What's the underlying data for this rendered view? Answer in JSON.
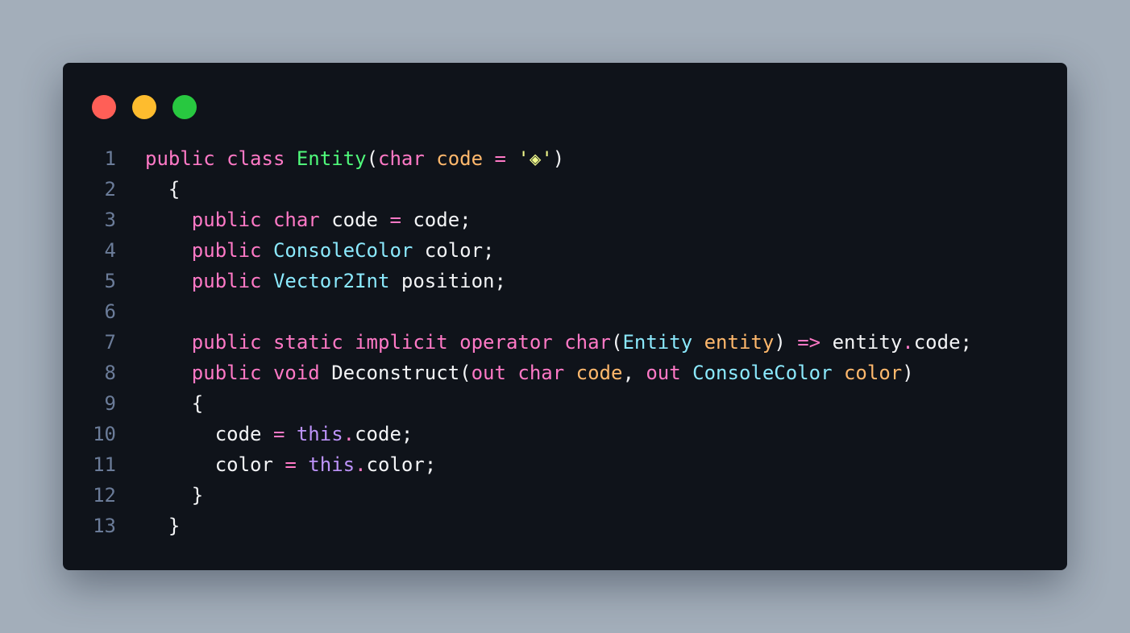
{
  "window": {
    "controls": {
      "close_color": "#ff5f57",
      "minimize_color": "#febc2e",
      "maximize_color": "#28c840"
    }
  },
  "code": {
    "lines": [
      {
        "number": "1",
        "tokens": [
          {
            "text": "public ",
            "kind": "kw"
          },
          {
            "text": "class ",
            "kind": "kw"
          },
          {
            "text": "Entity",
            "kind": "cls"
          },
          {
            "text": "(",
            "kind": "pl"
          },
          {
            "text": "char ",
            "kind": "kw"
          },
          {
            "text": "code ",
            "kind": "pr"
          },
          {
            "text": "= ",
            "kind": "op"
          },
          {
            "text": "'◈'",
            "kind": "st"
          },
          {
            "text": ")",
            "kind": "pl"
          }
        ]
      },
      {
        "number": "2",
        "tokens": [
          {
            "text": "  {",
            "kind": "pl"
          }
        ]
      },
      {
        "number": "3",
        "tokens": [
          {
            "text": "    public ",
            "kind": "kw"
          },
          {
            "text": "char ",
            "kind": "kw"
          },
          {
            "text": "code ",
            "kind": "pl"
          },
          {
            "text": "= ",
            "kind": "op"
          },
          {
            "text": "code;",
            "kind": "pl"
          }
        ]
      },
      {
        "number": "4",
        "tokens": [
          {
            "text": "    public ",
            "kind": "kw"
          },
          {
            "text": "ConsoleColor ",
            "kind": "ty"
          },
          {
            "text": "color;",
            "kind": "pl"
          }
        ]
      },
      {
        "number": "5",
        "tokens": [
          {
            "text": "    public ",
            "kind": "kw"
          },
          {
            "text": "Vector2Int ",
            "kind": "ty"
          },
          {
            "text": "position;",
            "kind": "pl"
          }
        ]
      },
      {
        "number": "6",
        "tokens": []
      },
      {
        "number": "7",
        "tokens": [
          {
            "text": "    public ",
            "kind": "kw"
          },
          {
            "text": "static ",
            "kind": "kw"
          },
          {
            "text": "implicit ",
            "kind": "kw"
          },
          {
            "text": "operator ",
            "kind": "kw"
          },
          {
            "text": "char",
            "kind": "kw"
          },
          {
            "text": "(",
            "kind": "pl"
          },
          {
            "text": "Entity ",
            "kind": "ty"
          },
          {
            "text": "entity",
            "kind": "pr"
          },
          {
            "text": ") ",
            "kind": "pl"
          },
          {
            "text": "=> ",
            "kind": "op"
          },
          {
            "text": "entity",
            "kind": "pl"
          },
          {
            "text": ".",
            "kind": "op"
          },
          {
            "text": "code;",
            "kind": "pl"
          }
        ]
      },
      {
        "number": "8",
        "tokens": [
          {
            "text": "    public ",
            "kind": "kw"
          },
          {
            "text": "void ",
            "kind": "kw"
          },
          {
            "text": "Deconstruct(",
            "kind": "pl"
          },
          {
            "text": "out ",
            "kind": "kw"
          },
          {
            "text": "char ",
            "kind": "kw"
          },
          {
            "text": "code",
            "kind": "pr"
          },
          {
            "text": ", ",
            "kind": "pl"
          },
          {
            "text": "out ",
            "kind": "kw"
          },
          {
            "text": "ConsoleColor ",
            "kind": "ty"
          },
          {
            "text": "color",
            "kind": "pr"
          },
          {
            "text": ")",
            "kind": "pl"
          }
        ]
      },
      {
        "number": "9",
        "tokens": [
          {
            "text": "    {",
            "kind": "pl"
          }
        ]
      },
      {
        "number": "10",
        "tokens": [
          {
            "text": "      code ",
            "kind": "pl"
          },
          {
            "text": "= ",
            "kind": "op"
          },
          {
            "text": "this",
            "kind": "th"
          },
          {
            "text": ".",
            "kind": "op"
          },
          {
            "text": "code;",
            "kind": "pl"
          }
        ]
      },
      {
        "number": "11",
        "tokens": [
          {
            "text": "      color ",
            "kind": "pl"
          },
          {
            "text": "= ",
            "kind": "op"
          },
          {
            "text": "this",
            "kind": "th"
          },
          {
            "text": ".",
            "kind": "op"
          },
          {
            "text": "color;",
            "kind": "pl"
          }
        ]
      },
      {
        "number": "12",
        "tokens": [
          {
            "text": "    }",
            "kind": "pl"
          }
        ]
      },
      {
        "number": "13",
        "tokens": [
          {
            "text": "  }",
            "kind": "pl"
          }
        ]
      }
    ]
  }
}
